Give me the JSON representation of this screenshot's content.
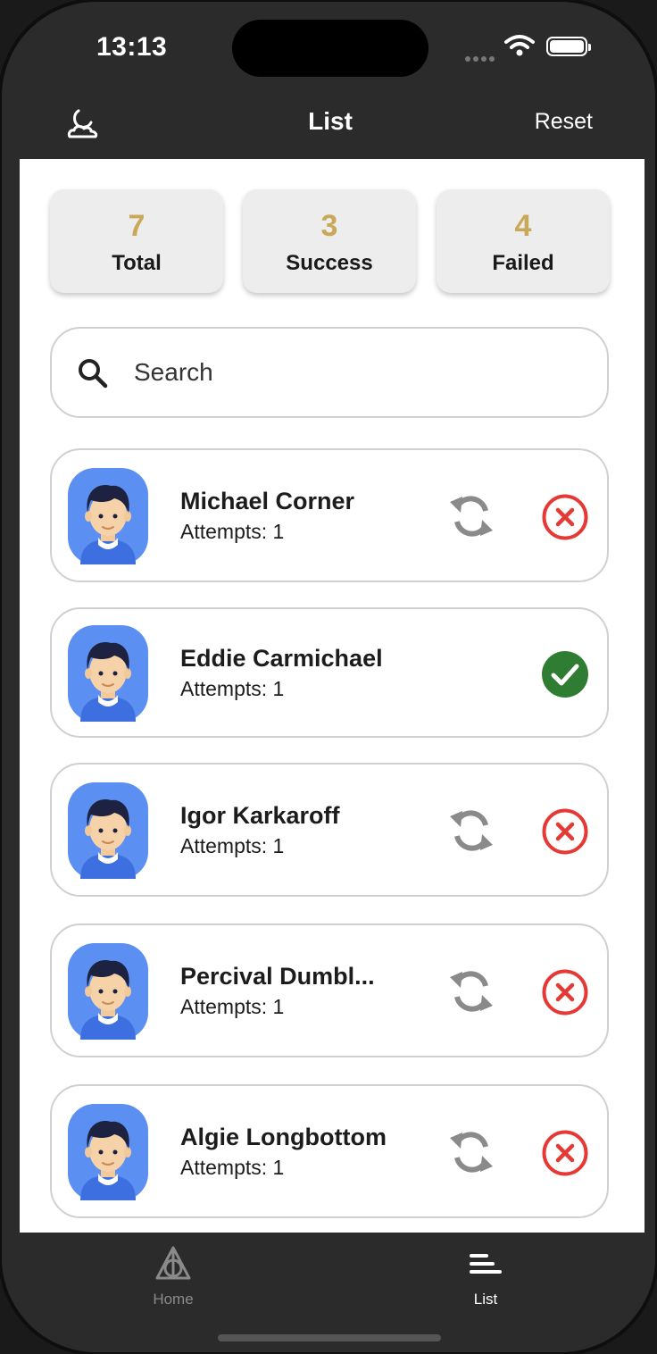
{
  "status_bar": {
    "time": "13:13"
  },
  "app_bar": {
    "title": "List",
    "reset_label": "Reset",
    "logo_icon": "cloud-moon-icon"
  },
  "stats": [
    {
      "value": "7",
      "label": "Total"
    },
    {
      "value": "3",
      "label": "Success"
    },
    {
      "value": "4",
      "label": "Failed"
    }
  ],
  "search": {
    "placeholder": "Search"
  },
  "list": [
    {
      "name": "Michael Corner",
      "attempts": "Attempts: 1",
      "status": "failed"
    },
    {
      "name": "Eddie Carmichael",
      "attempts": "Attempts: 1",
      "status": "success"
    },
    {
      "name": "Igor Karkaroff",
      "attempts": "Attempts: 1",
      "status": "failed"
    },
    {
      "name": "Percival Dumbl...",
      "attempts": "Attempts: 1",
      "status": "failed"
    },
    {
      "name": "Algie Longbottom",
      "attempts": "Attempts: 1",
      "status": "failed"
    }
  ],
  "tab_bar": {
    "items": [
      {
        "label": "Home",
        "icon": "deathly-hallows-icon",
        "active": false
      },
      {
        "label": "List",
        "icon": "list-icon",
        "active": true
      }
    ]
  },
  "colors": {
    "stat_number": "#c9a85a",
    "failed": "#e53935",
    "success": "#2e7d32",
    "avatar_bg": "#5b8ff2",
    "bar_bg": "#2b2b2b"
  }
}
